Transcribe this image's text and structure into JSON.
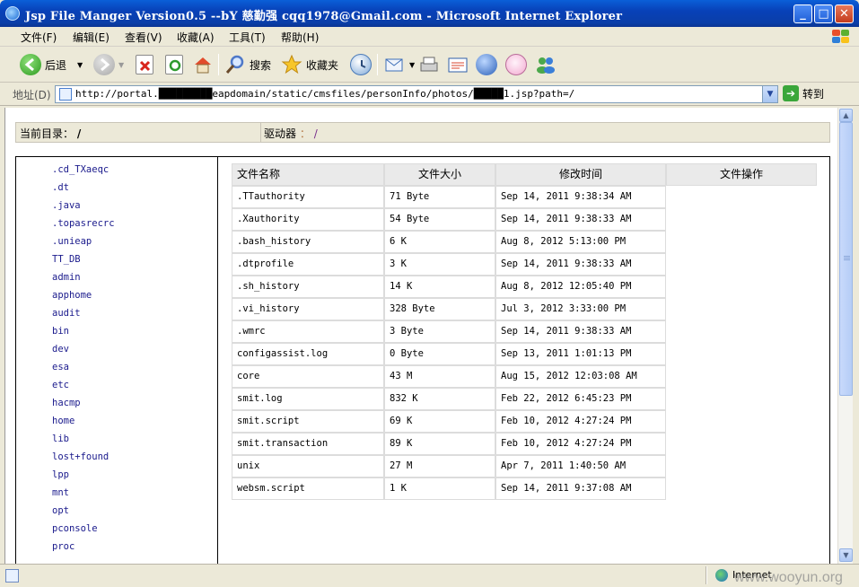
{
  "window": {
    "title": "Jsp File Manger Version0.5 --bY 慈勤强 cqq1978@Gmail.com - Microsoft Internet Explorer",
    "buttons": {
      "minimize": "_",
      "maximize": "□",
      "close": "✕"
    }
  },
  "menu": [
    "文件(F)",
    "编辑(E)",
    "查看(V)",
    "收藏(A)",
    "工具(T)",
    "帮助(H)"
  ],
  "toolbar": {
    "back_label": "后退",
    "search_label": "搜索",
    "favorites_label": "收藏夹"
  },
  "address": {
    "label": "地址(D)",
    "url": "http://portal.█████████eapdomain/static/cmsfiles/personInfo/photos/█████1.jsp?path=/",
    "go_label": "转到"
  },
  "page": {
    "current_dir_label": "当前目录：",
    "current_dir_value": "/",
    "drive_label": "驱动器",
    "drive_colon": "：",
    "drive_value": "/"
  },
  "tree": [
    ".cd_TXaeqc",
    ".dt",
    ".java",
    ".topasrecrc",
    ".unieap",
    "TT_DB",
    "admin",
    "apphome",
    "audit",
    "bin",
    "dev",
    "esa",
    "etc",
    "hacmp",
    "home",
    "lib",
    "lost+found",
    "lpp",
    "mnt",
    "opt",
    "pconsole",
    "proc"
  ],
  "table": {
    "headers": [
      "文件名称",
      "文件大小",
      "修改时间",
      "文件操作"
    ],
    "rows": [
      [
        ".TTauthority",
        "71 Byte",
        "Sep 14, 2011 9:38:34 AM"
      ],
      [
        ".Xauthority",
        "54 Byte",
        "Sep 14, 2011 9:38:33 AM"
      ],
      [
        ".bash_history",
        "6 K",
        "Aug 8, 2012 5:13:00 PM"
      ],
      [
        ".dtprofile",
        "3 K",
        "Sep 14, 2011 9:38:33 AM"
      ],
      [
        ".sh_history",
        "14 K",
        "Aug 8, 2012 12:05:40 PM"
      ],
      [
        ".vi_history",
        "328 Byte",
        "Jul 3, 2012 3:33:00 PM"
      ],
      [
        ".wmrc",
        "3 Byte",
        "Sep 14, 2011 9:38:33 AM"
      ],
      [
        "configassist.log",
        "0 Byte",
        "Sep 13, 2011 1:01:13 PM"
      ],
      [
        "core",
        "43 M",
        "Aug 15, 2012 12:03:08 AM"
      ],
      [
        "smit.log",
        "832 K",
        "Feb 22, 2012 6:45:23 PM"
      ],
      [
        "smit.script",
        "69 K",
        "Feb 10, 2012 4:27:24 PM"
      ],
      [
        "smit.transaction",
        "89 K",
        "Feb 10, 2012 4:27:24 PM"
      ],
      [
        "unix",
        "27 M",
        "Apr 7, 2011 1:40:50 AM"
      ],
      [
        "websm.script",
        "1 K",
        "Sep 14, 2011 9:37:08 AM"
      ]
    ]
  },
  "status": {
    "zone": "Internet",
    "watermark": "www.wooyun.org"
  }
}
